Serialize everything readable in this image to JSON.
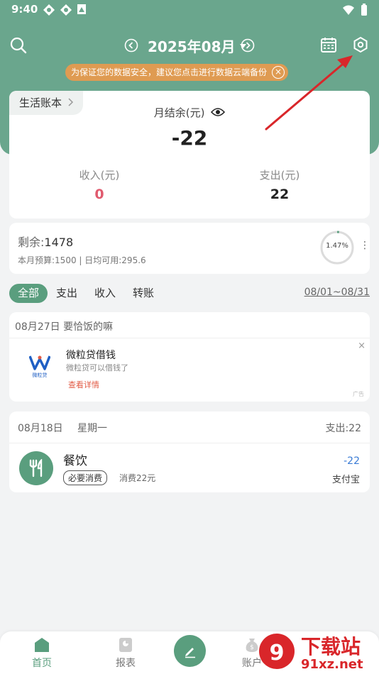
{
  "status_bar": {
    "time": "9:40"
  },
  "header": {
    "month": "2025年08月",
    "banner_text": "为保证您的数据安全，建议您点击进行数据云端备份",
    "banner_close": "×"
  },
  "summary": {
    "book_name": "生活账本",
    "balance_label": "月结余(元)",
    "balance_value": "-22",
    "income_label": "收入(元)",
    "income_value": "0",
    "expense_label": "支出(元)",
    "expense_value": "22",
    "income_color": "#e05a6e"
  },
  "budget": {
    "remaining_label": "剩余:",
    "remaining_value": "1478",
    "detail": "本月预算:1500 | 日均可用:295.6",
    "percent_text": "1.47%",
    "percent": 1.47
  },
  "filters": {
    "tabs": [
      "全部",
      "支出",
      "收入",
      "转账"
    ],
    "active": "全部",
    "date_range": "08/01~08/31"
  },
  "ad": {
    "date_line": "08月27日  要恰饭的嘛",
    "logo_text": "微粒贷",
    "title": "微粒贷借钱",
    "subtitle": "微粒贷可以借钱了",
    "link": "查看详情",
    "close": "×",
    "badge": "广告"
  },
  "transactions": {
    "date": "08月18日",
    "weekday": "星期一",
    "total": "支出:22",
    "items": [
      {
        "category": "餐饮",
        "tag": "必要消费",
        "note": "消费22元",
        "amount": "-22",
        "account": "支付宝"
      }
    ]
  },
  "bottom_nav": {
    "home": "首页",
    "reports": "报表",
    "accounts": "账户"
  },
  "watermark": {
    "text1": "下载站",
    "text2": "91xz.net"
  },
  "colors": {
    "primary": "#6aa68d",
    "accent": "#5a9e7e",
    "banner": "#df9b52",
    "arrow": "#d9262a"
  }
}
